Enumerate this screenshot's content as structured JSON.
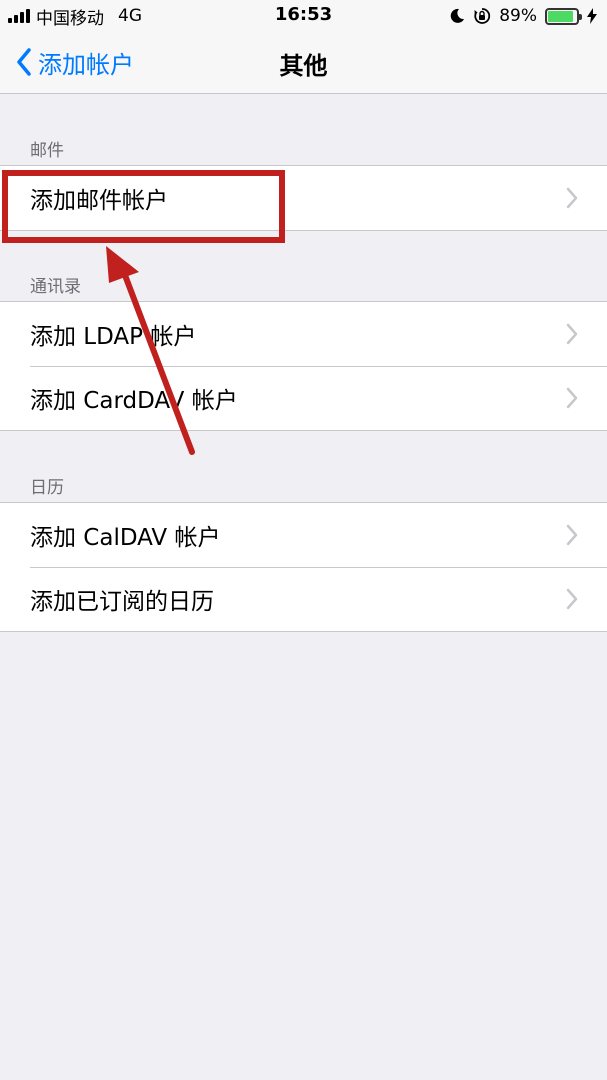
{
  "status_bar": {
    "carrier": "中国移动",
    "network": "4G",
    "time": "16:53",
    "battery_percent": "89%",
    "battery_level": 0.89
  },
  "nav": {
    "back_label": "添加帐户",
    "title": "其他"
  },
  "sections": [
    {
      "header": "邮件",
      "items": [
        "添加邮件帐户"
      ]
    },
    {
      "header": "通讯录",
      "items": [
        "添加 LDAP 帐户",
        "添加 CardDAV 帐户"
      ]
    },
    {
      "header": "日历",
      "items": [
        "添加 CalDAV 帐户",
        "添加已订阅的日历"
      ]
    }
  ],
  "colors": {
    "accent": "#007aff",
    "annotation": "#c0201e",
    "battery": "#4cd964",
    "background": "#efeff4"
  },
  "icons": {
    "back": "chevron-left-icon",
    "disclosure": "chevron-right-icon",
    "moon": "moon-icon",
    "orientation_lock": "orientation-lock-icon",
    "charging": "bolt-icon"
  }
}
